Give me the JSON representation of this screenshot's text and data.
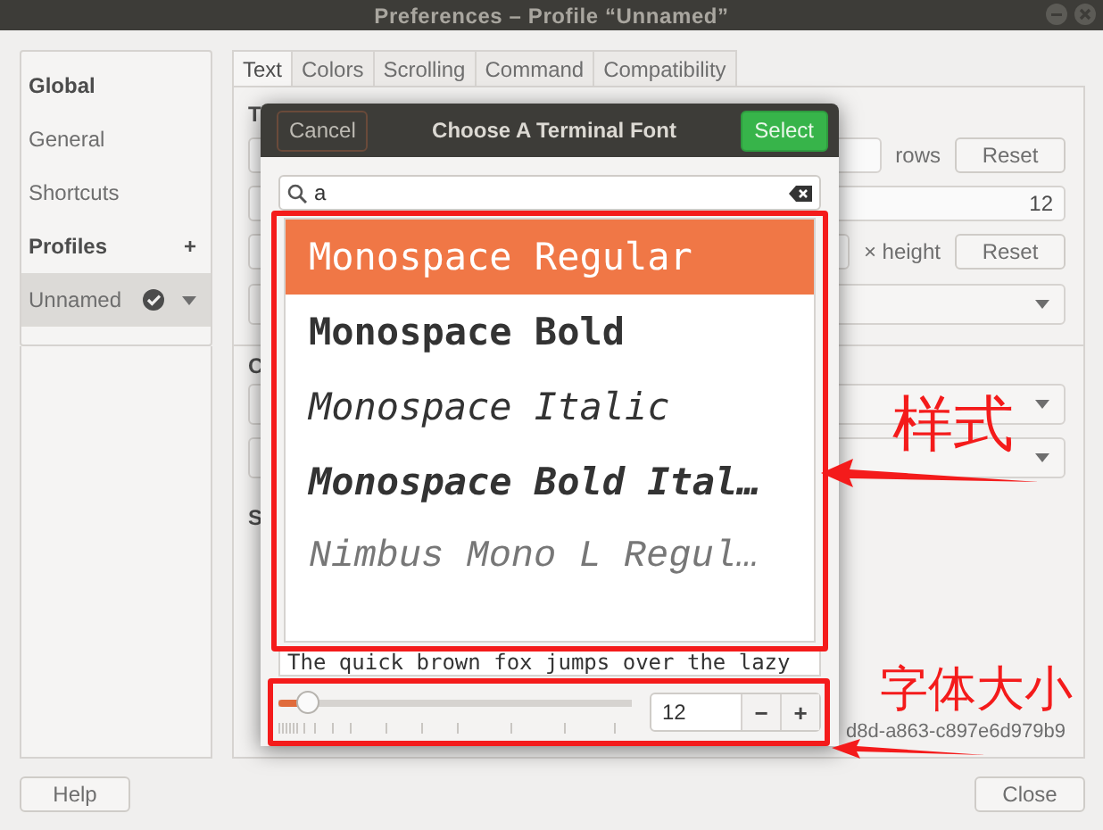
{
  "window": {
    "title": "Preferences – Profile “Unnamed”"
  },
  "sidebar": {
    "items": [
      {
        "label": "Global",
        "kind": "header"
      },
      {
        "label": "General",
        "kind": "item",
        "selected": false
      },
      {
        "label": "Shortcuts",
        "kind": "item",
        "selected": false
      },
      {
        "label": "Profiles",
        "kind": "header",
        "action": "+"
      },
      {
        "label": "Unnamed",
        "kind": "profile",
        "selected": true
      }
    ]
  },
  "tabs": [
    {
      "label": "Text",
      "selected": true
    },
    {
      "label": "Colors",
      "selected": false
    },
    {
      "label": "Scrolling",
      "selected": false
    },
    {
      "label": "Command",
      "selected": false
    },
    {
      "label": "Compatibility",
      "selected": false
    }
  ],
  "profile_form": {
    "headings": [
      "T",
      "C",
      "S"
    ],
    "rows_label": "rows",
    "reset_buttons": [
      "Reset",
      "Reset"
    ],
    "font_size_value": "12",
    "height_label": "× height",
    "uuid": "d8d-a863-c897e6d979b9"
  },
  "buttons": [
    "Help",
    "Close"
  ],
  "font_dialog": {
    "cancel": "Cancel",
    "title": "Choose A Terminal Font",
    "select": "Select",
    "search_value": "a",
    "fonts": [
      {
        "name": "Monospace Regular",
        "kind": "regular",
        "selected": true
      },
      {
        "name": "Monospace Bold",
        "kind": "bold",
        "selected": false
      },
      {
        "name": "Monospace Italic",
        "kind": "italic",
        "selected": false
      },
      {
        "name": "Monospace Bold Ital…",
        "kind": "bolditalic",
        "selected": false
      },
      {
        "name": "Nimbus Mono L Regul…",
        "kind": "serif",
        "selected": false
      }
    ],
    "preview": "The quick brown fox jumps over the lazy",
    "size": {
      "level": 0.08,
      "value": "12",
      "minus": "−",
      "plus": "+"
    }
  },
  "annotations": [
    {
      "text": "样式"
    },
    {
      "text": "字体大小"
    }
  ]
}
